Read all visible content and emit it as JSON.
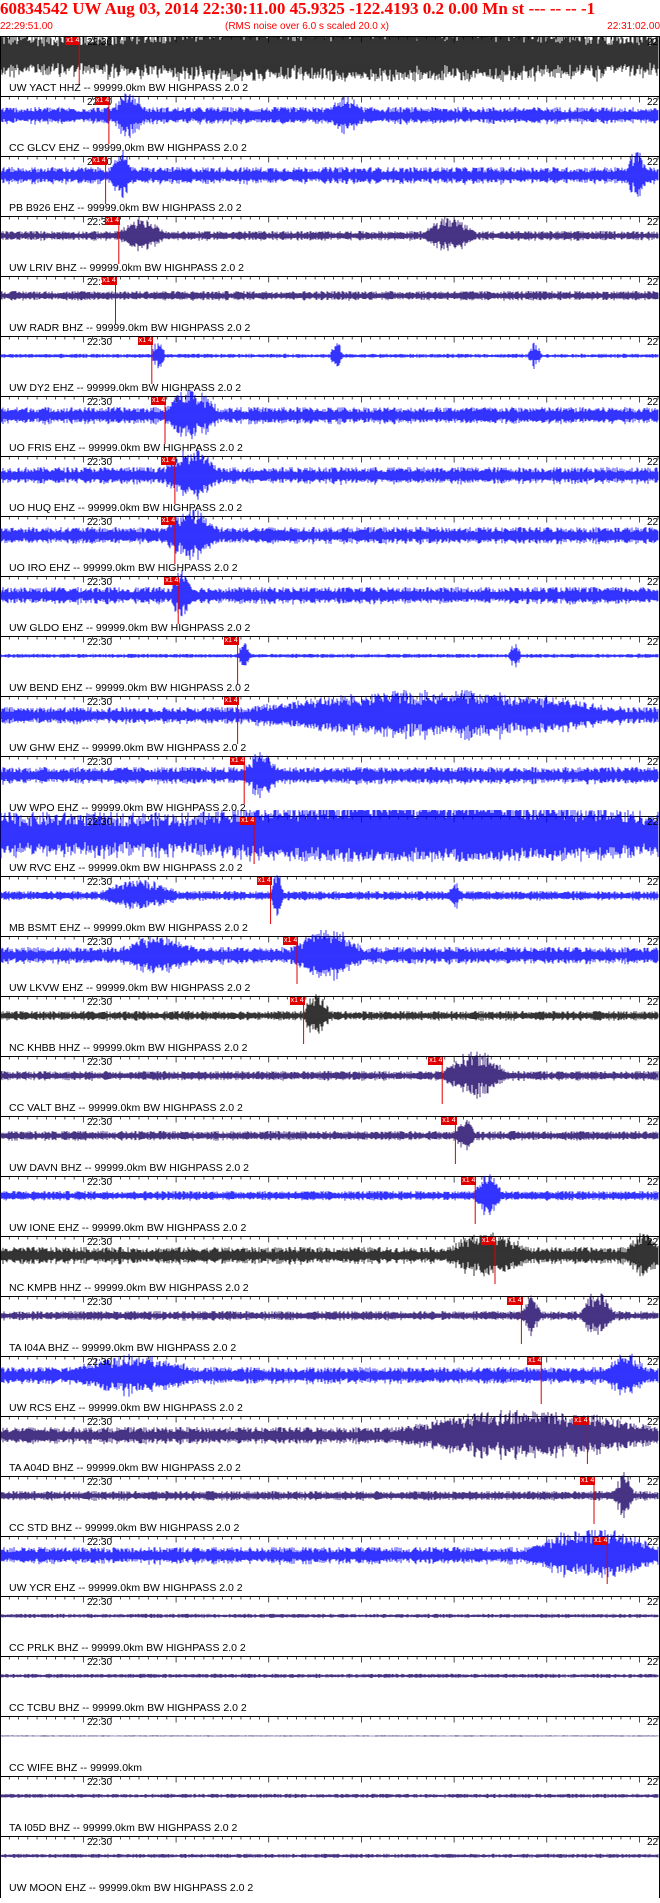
{
  "header": {
    "title": "60834542 UW Aug 03, 2014 22:30:11.00   45.9325 -122.4193  0.2 0.00 Mn st --- -- --   -1",
    "start_time": "22:29:51.00",
    "noise_note": "(RMS noise over 6.0 s scaled 20.0 x)",
    "end_time": "22:31:02.00"
  },
  "tick_labels": {
    "minute": "22:30",
    "right_edge": "22"
  },
  "pick_label": "x1 4",
  "colors": {
    "header_red": "#ff0000",
    "pick_red": "#e00000",
    "grid": "#000000"
  },
  "traces": [
    {
      "label": "UW YACT HHZ -- 99999.0km BW  HIGHPASS  2.0  2",
      "color": "#000000",
      "pick": 0.12,
      "amp": "high",
      "bursts": [
        [
          0.15,
          0.95,
          0.7
        ]
      ]
    },
    {
      "label": "CC GLCV EHZ -- 99999.0km BW  HIGHPASS  2.0  2",
      "color": "#0000ff",
      "pick": 0.165,
      "amp": "med",
      "bursts": [
        [
          0.17,
          0.22,
          0.8
        ],
        [
          0.5,
          0.55,
          0.5
        ]
      ]
    },
    {
      "label": "PB B926 EHZ -- 99999.0km BW  HIGHPASS  2.0  2",
      "color": "#0000ff",
      "pick": 0.16,
      "amp": "med",
      "bursts": [
        [
          0.17,
          0.2,
          0.9
        ],
        [
          0.95,
          0.98,
          1.0
        ]
      ]
    },
    {
      "label": "UW LRIV BHZ -- 99999.0km BW  HIGHPASS  2.0  2",
      "color": "#1a0066",
      "pick": 0.18,
      "amp": "low",
      "bursts": [
        [
          0.18,
          0.25,
          0.6
        ],
        [
          0.64,
          0.72,
          0.7
        ]
      ]
    },
    {
      "label": "UW RADR BHZ -- 99999.0km BW  HIGHPASS  2.0  2",
      "color": "#1a0066",
      "pick": 0.175,
      "amp": "low",
      "bursts": []
    },
    {
      "label": "UW DY2 EHZ -- 99999.0km BW  HIGHPASS  2.0  2",
      "color": "#0000ff",
      "pick": 0.23,
      "amp": "tiny",
      "bursts": [
        [
          0.23,
          0.25,
          0.8
        ],
        [
          0.5,
          0.52,
          0.6
        ],
        [
          0.8,
          0.82,
          0.6
        ]
      ]
    },
    {
      "label": "UO FRIS EHZ -- 99999.0km BW  HIGHPASS  2.0  2",
      "color": "#0000ff",
      "pick": 0.25,
      "amp": "med",
      "bursts": [
        [
          0.25,
          0.33,
          1.0
        ]
      ]
    },
    {
      "label": "UO HUQ EHZ -- 99999.0km BW  HIGHPASS  2.0  2",
      "color": "#0000ff",
      "pick": 0.265,
      "amp": "med",
      "bursts": [
        [
          0.25,
          0.33,
          1.0
        ]
      ]
    },
    {
      "label": "UO IRO EHZ -- 99999.0km BW  HIGHPASS  2.0  2",
      "color": "#0000ff",
      "pick": 0.265,
      "amp": "med",
      "bursts": [
        [
          0.25,
          0.33,
          1.0
        ]
      ]
    },
    {
      "label": "UW GLDO EHZ -- 99999.0km BW  HIGHPASS  2.0  2",
      "color": "#0000ff",
      "pick": 0.27,
      "amp": "med",
      "bursts": [
        [
          0.26,
          0.29,
          1.0
        ]
      ]
    },
    {
      "label": "UW BEND EHZ -- 99999.0km BW  HIGHPASS  2.0  2",
      "color": "#0000ff",
      "pick": 0.36,
      "amp": "tiny",
      "bursts": [
        [
          0.36,
          0.38,
          0.6
        ],
        [
          0.77,
          0.79,
          0.5
        ]
      ]
    },
    {
      "label": "UW GHW EHZ -- 99999.0km BW  HIGHPASS  2.0  2",
      "color": "#0000ff",
      "pick": 0.36,
      "amp": "med",
      "bursts": [
        [
          0.37,
          0.95,
          0.9
        ]
      ]
    },
    {
      "label": "UW WPO EHZ -- 99999.0km BW  HIGHPASS  2.0  2",
      "color": "#0000ff",
      "pick": 0.37,
      "amp": "med",
      "bursts": [
        [
          0.37,
          0.42,
          0.8
        ]
      ]
    },
    {
      "label": "UW RVC EHZ -- 99999.0km BW  HIGHPASS  2.0  2",
      "color": "#0000ff",
      "pick": 0.385,
      "amp": "high",
      "bursts": [
        [
          0.28,
          1.0,
          0.9
        ]
      ]
    },
    {
      "label": "MB BSMT EHZ -- 99999.0km BW  HIGHPASS  2.0  2",
      "color": "#0000ff",
      "pick": 0.41,
      "amp": "low",
      "bursts": [
        [
          0.15,
          0.27,
          0.6
        ],
        [
          0.41,
          0.43,
          0.9
        ],
        [
          0.68,
          0.7,
          0.4
        ]
      ]
    },
    {
      "label": "UW LKVW EHZ -- 99999.0km BW  HIGHPASS  2.0  2",
      "color": "#0000ff",
      "pick": 0.45,
      "amp": "med",
      "bursts": [
        [
          0.18,
          0.3,
          0.6
        ],
        [
          0.44,
          0.55,
          1.0
        ]
      ]
    },
    {
      "label": "NC KHBB HHZ -- 99999.0km BW  HIGHPASS  2.0  2",
      "color": "#000000",
      "pick": 0.46,
      "amp": "low",
      "bursts": [
        [
          0.46,
          0.5,
          1.0
        ]
      ]
    },
    {
      "label": "CC VALT BHZ -- 99999.0km BW  HIGHPASS  2.0  2",
      "color": "#1a0066",
      "pick": 0.67,
      "amp": "low",
      "bursts": [
        [
          0.67,
          0.77,
          1.0
        ]
      ]
    },
    {
      "label": "UW DAVN BHZ -- 99999.0km BW  HIGHPASS  2.0  2",
      "color": "#1a0066",
      "pick": 0.69,
      "amp": "low",
      "bursts": [
        [
          0.69,
          0.72,
          0.6
        ]
      ]
    },
    {
      "label": "UW IONE EHZ -- 99999.0km BW  HIGHPASS  2.0  2",
      "color": "#0000ff",
      "pick": 0.72,
      "amp": "low",
      "bursts": [
        [
          0.72,
          0.76,
          1.0
        ]
      ]
    },
    {
      "label": "NC KMPB HHZ -- 99999.0km BW  HIGHPASS  2.0  2",
      "color": "#000000",
      "pick": 0.75,
      "amp": "med",
      "bursts": [
        [
          0.68,
          0.8,
          0.8
        ],
        [
          0.95,
          1.0,
          0.8
        ]
      ]
    },
    {
      "label": "TA I04A BHZ -- 99999.0km BW  HIGHPASS  2.0  2",
      "color": "#1a0066",
      "pick": 0.79,
      "amp": "low",
      "bursts": [
        [
          0.79,
          0.82,
          0.9
        ],
        [
          0.88,
          0.93,
          1.0
        ]
      ]
    },
    {
      "label": "UW RCS EHZ -- 99999.0km BW  HIGHPASS  2.0  2",
      "color": "#0000ff",
      "pick": 0.82,
      "amp": "med",
      "bursts": [
        [
          0.1,
          0.3,
          0.6
        ],
        [
          0.92,
          0.98,
          0.8
        ]
      ]
    },
    {
      "label": "TA A04D BHZ -- 99999.0km BW  HIGHPASS  2.0  2",
      "color": "#1a0066",
      "pick": 0.89,
      "amp": "med",
      "bursts": [
        [
          0.6,
          1.0,
          0.9
        ]
      ]
    },
    {
      "label": "CC STD BHZ -- 99999.0km BW  HIGHPASS  2.0  2",
      "color": "#1a0066",
      "pick": 0.9,
      "amp": "low",
      "bursts": [
        [
          0.93,
          0.96,
          1.0
        ]
      ]
    },
    {
      "label": "UW YCR EHZ -- 99999.0km BW  HIGHPASS  2.0  2",
      "color": "#0000ff",
      "pick": 0.92,
      "amp": "med",
      "bursts": [
        [
          0.8,
          1.0,
          1.0
        ]
      ]
    },
    {
      "label": "CC PRLK BHZ -- 99999.0km BW  HIGHPASS  2.0  2",
      "color": "#1a0066",
      "pick": null,
      "amp": "tiny",
      "bursts": []
    },
    {
      "label": "CC TCBU BHZ -- 99999.0km BW  HIGHPASS  2.0  2",
      "color": "#1a0066",
      "pick": null,
      "amp": "tiny",
      "bursts": []
    },
    {
      "label": "CC WIFE BHZ -- 99999.0km",
      "color": "#1a0066",
      "pick": null,
      "amp": "none",
      "bursts": []
    },
    {
      "label": "TA I05D BHZ -- 99999.0km BW  HIGHPASS  2.0  2",
      "color": "#1a0066",
      "pick": null,
      "amp": "tiny",
      "bursts": []
    },
    {
      "label": "UW MOON EHZ -- 99999.0km BW  HIGHPASS  2.0  2",
      "color": "#1a0066",
      "pick": null,
      "amp": "tiny",
      "bursts": []
    }
  ]
}
